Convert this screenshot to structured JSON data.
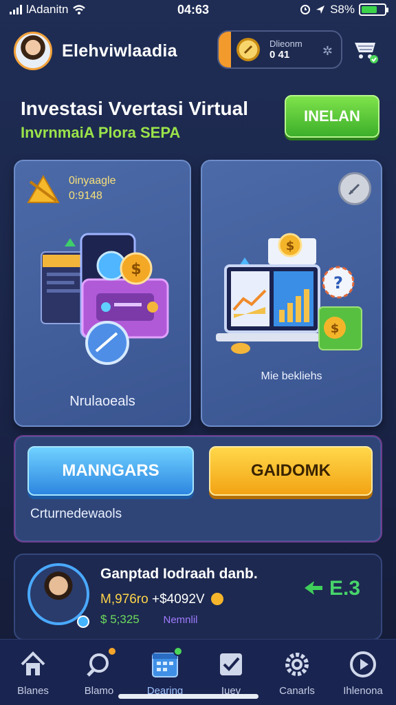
{
  "status_bar": {
    "carrier": "lAdanitn",
    "time": "04:63",
    "battery_text": "S8%"
  },
  "header": {
    "app_name": "Elehviwlaadia",
    "coin_pill": {
      "line1": "Dlieonm",
      "line2": "0 41"
    }
  },
  "hero": {
    "title": "Investasi Vvertasi Virtual",
    "subtitle": "InvrnmaiA Plora SEPA",
    "button_label": "INELAN"
  },
  "cards": {
    "left": {
      "label_line1": "0inyaagle",
      "label_line2": "0:9148",
      "bottom_label": "Nrulaoeals"
    },
    "right": {
      "bottom_label": "Mie bekliehs"
    }
  },
  "actions": {
    "primary_label": "MANNGARS",
    "secondary_label": "GAIDOMK",
    "caption": "Crturnedewaols"
  },
  "profile": {
    "name": "Ganptad Iodraah danb.",
    "stat1_a": "M,976ro",
    "stat1_b": "+$4092V",
    "stat2_a": "5;325",
    "stat2_b": "Nemnlil",
    "score": "E.3"
  },
  "tabs": [
    {
      "label": "Blanes",
      "icon": "home-icon"
    },
    {
      "label": "Blamo",
      "icon": "search-icon"
    },
    {
      "label": "Dearing",
      "icon": "calendar-icon"
    },
    {
      "label": "Iuev",
      "icon": "checklist-icon"
    },
    {
      "label": "Canarls",
      "icon": "gear-icon"
    },
    {
      "label": "Ihlenona",
      "icon": "play-icon"
    }
  ],
  "colors": {
    "background": "#1f2d55",
    "accent_green": "#4bd65a",
    "accent_yellow": "#f2a314",
    "accent_blue": "#2d86e0"
  }
}
